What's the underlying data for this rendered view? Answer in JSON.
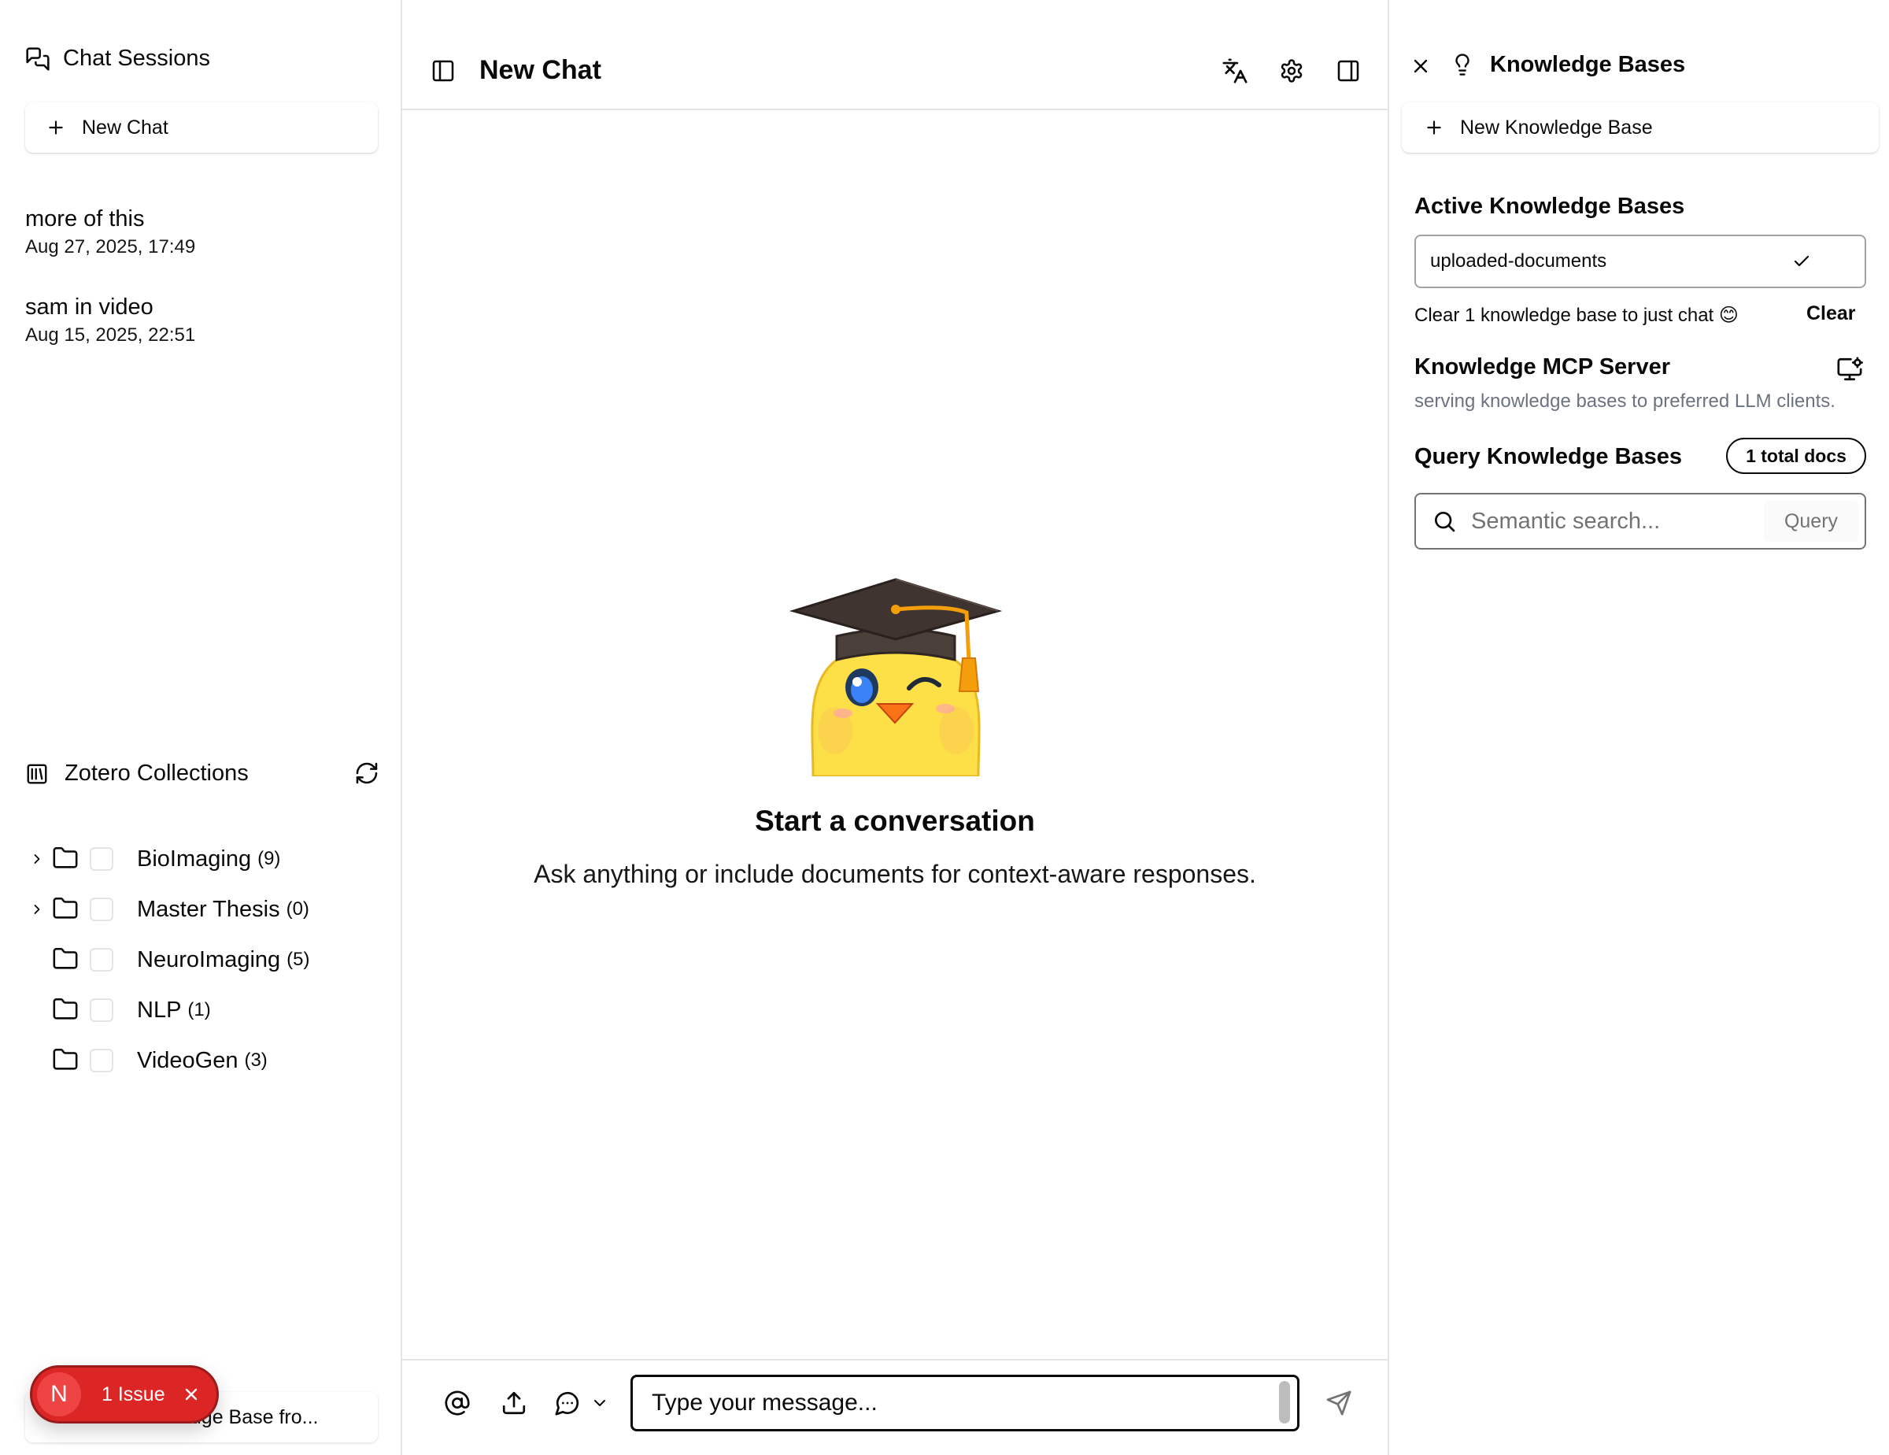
{
  "left": {
    "chat_sessions_title": "Chat Sessions",
    "new_chat_label": "New Chat",
    "sessions": [
      {
        "title": "more of this",
        "date": "Aug 27, 2025, 17:49"
      },
      {
        "title": "sam in video",
        "date": "Aug 15, 2025, 22:51"
      }
    ],
    "zotero_title": "Zotero Collections",
    "collections": [
      {
        "name": "BioImaging",
        "count": "(9)",
        "expandable": true
      },
      {
        "name": "Master Thesis",
        "count": "(0)",
        "expandable": true
      },
      {
        "name": "NeuroImaging",
        "count": "(5)",
        "expandable": false
      },
      {
        "name": "NLP",
        "count": "(1)",
        "expandable": false
      },
      {
        "name": "VideoGen",
        "count": "(3)",
        "expandable": false
      }
    ],
    "kb_from_button": "edge Base fro..."
  },
  "center": {
    "title": "New Chat",
    "empty_title": "Start a conversation",
    "empty_subtitle": "Ask anything or include documents for context-aware responses.",
    "input_placeholder": "Type your message..."
  },
  "right": {
    "title": "Knowledge Bases",
    "new_kb_label": "New Knowledge Base",
    "active_label": "Active Knowledge Bases",
    "selected_kb": "uploaded-documents",
    "clear_hint": "Clear 1 knowledge base to just chat 😊",
    "clear_label": "Clear",
    "mcp_title": "Knowledge MCP Server",
    "mcp_desc": "serving knowledge bases to preferred LLM clients.",
    "query_title": "Query Knowledge Bases",
    "docs_badge": "1 total docs",
    "search_placeholder": "Semantic search...",
    "query_label": "Query"
  },
  "issue": {
    "avatar_letter": "N",
    "label": "1 Issue"
  },
  "colors": {
    "border": "#e5e5e5",
    "text": "#0a0a0a",
    "muted": "#737373",
    "issue_red": "#dc2626"
  }
}
